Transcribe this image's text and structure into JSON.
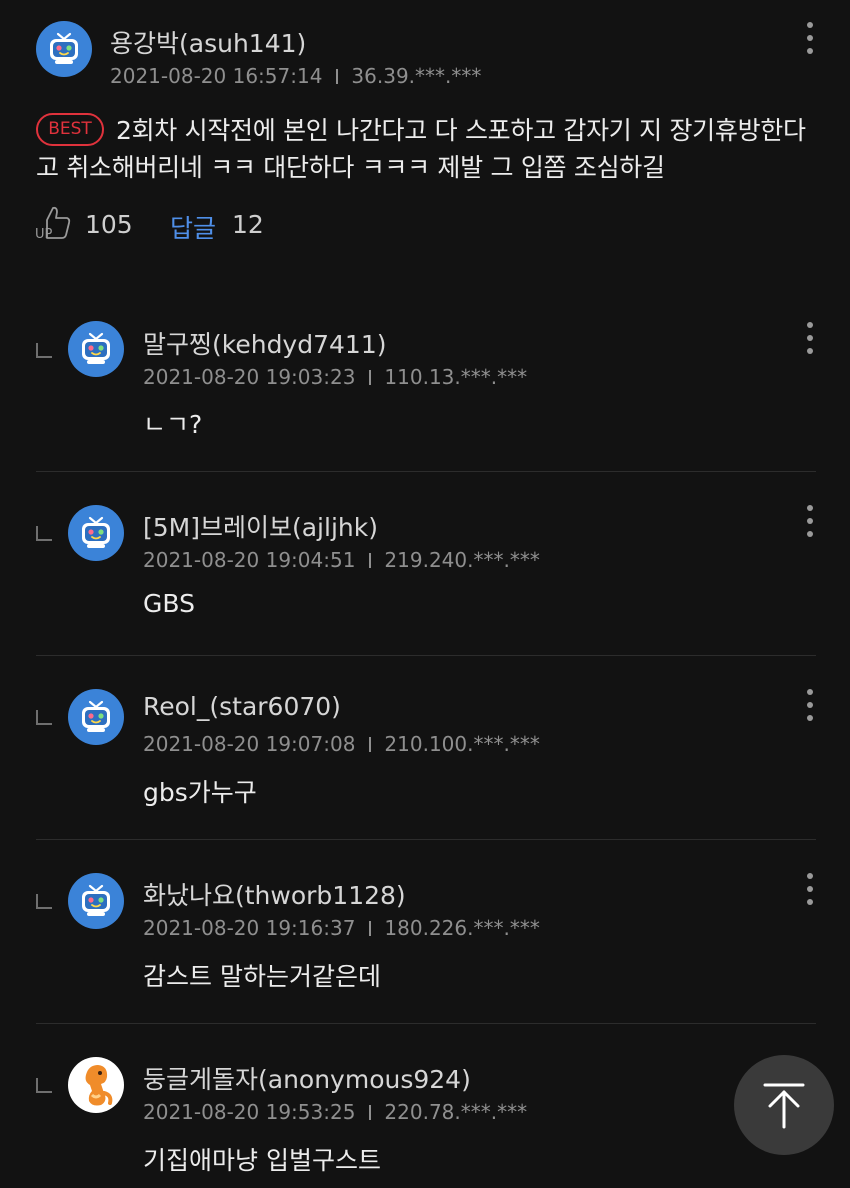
{
  "best_comment": {
    "nickname": "용강박(asuh141)",
    "datetime": "2021-08-20 16:57:14",
    "ip": "36.39.***.***",
    "badge": "BEST",
    "text": "2회차 시작전에 본인 나간다고 다 스포하고 갑자기 지 장기휴방한다고 취소해버리네 ㅋㅋ 대단하다 ㅋㅋㅋ 제발 그 입쫌 조심하길",
    "like_icon_label": "UP",
    "likes": "105",
    "reply_label": "답글",
    "reply_count": "12"
  },
  "replies": [
    {
      "nickname": "말구찡(kehdyd7411)",
      "datetime": "2021-08-20 19:03:23",
      "ip": "110.13.***.***",
      "text": "ㄴㄱ?"
    },
    {
      "nickname": "[5M]브레이보(ajljhk)",
      "datetime": "2021-08-20 19:04:51",
      "ip": "219.240.***.***",
      "text": "GBS"
    },
    {
      "nickname": "Reol_(star6070)",
      "datetime": "2021-08-20 19:07:08",
      "ip": "210.100.***.***",
      "text": "gbs가누구"
    },
    {
      "nickname": "화났나요(thworb1128)",
      "datetime": "2021-08-20 19:16:37",
      "ip": "180.226.***.***",
      "text": "감스트 말하는거같은데"
    },
    {
      "nickname": "둥글게돌자(anonymous924)",
      "datetime": "2021-08-20 19:53:25",
      "ip": "220.78.***.***",
      "text": "기집애마냥 입벌구스트"
    }
  ],
  "icons": {
    "avatar_default": "tv-mascot-icon",
    "avatar_custom": "orange-character-icon",
    "more": "kebab-menu-icon",
    "like": "thumbs-up-icon",
    "scroll_top": "arrow-up-icon"
  },
  "colors": {
    "background": "#121212",
    "best_badge": "#e0323c",
    "reply_link": "#4f8fe8",
    "avatar_blue": "#3b83d8"
  }
}
